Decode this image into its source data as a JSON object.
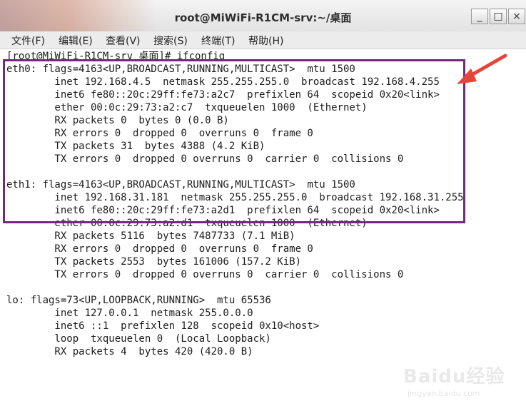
{
  "window": {
    "title": "root@MiWiFi-R1CM-srv:~/桌面",
    "buttons": {
      "minimize": "_",
      "maximize": "□",
      "close": "×"
    }
  },
  "menu": [
    "文件(F)",
    "编辑(E)",
    "查看(V)",
    "搜索(S)",
    "终端(T)",
    "帮助(H)"
  ],
  "terminal": {
    "lines": [
      "[root@MiWiFi-R1CM-srv 桌面]# ifconfig",
      "eth0: flags=4163<UP,BROADCAST,RUNNING,MULTICAST>  mtu 1500",
      "        inet 192.168.4.5  netmask 255.255.255.0  broadcast 192.168.4.255",
      "        inet6 fe80::20c:29ff:fe73:a2c7  prefixlen 64  scopeid 0x20<link>",
      "        ether 00:0c:29:73:a2:c7  txqueuelen 1000  (Ethernet)",
      "        RX packets 0  bytes 0 (0.0 B)",
      "        RX errors 0  dropped 0  overruns 0  frame 0",
      "        TX packets 31  bytes 4388 (4.2 KiB)",
      "        TX errors 0  dropped 0 overruns 0  carrier 0  collisions 0",
      "",
      "eth1: flags=4163<UP,BROADCAST,RUNNING,MULTICAST>  mtu 1500",
      "        inet 192.168.31.181  netmask 255.255.255.0  broadcast 192.168.31.255",
      "        inet6 fe80::20c:29ff:fe73:a2d1  prefixlen 64  scopeid 0x20<link>",
      "        ether 00:0c:29:73:a2:d1  txqueuelen 1000  (Ethernet)",
      "        RX packets 5116  bytes 7487733 (7.1 MiB)",
      "        RX errors 0  dropped 0  overruns 0  frame 0",
      "        TX packets 2553  bytes 161006 (157.2 KiB)",
      "        TX errors 0  dropped 0 overruns 0  carrier 0  collisions 0",
      "",
      "lo: flags=73<UP,LOOPBACK,RUNNING>  mtu 65536",
      "        inet 127.0.0.1  netmask 255.0.0.0",
      "        inet6 ::1  prefixlen 128  scopeid 0x10<host>",
      "        loop  txqueuelen 0  (Local Loopback)",
      "        RX packets 4  bytes 420 (420.0 B)"
    ]
  },
  "watermark": {
    "logo": "Baidu经验",
    "url": "jingyan.baidu.com"
  },
  "colors": {
    "highlight_box": "#6f2a7a",
    "arrow": "#e8433a"
  }
}
